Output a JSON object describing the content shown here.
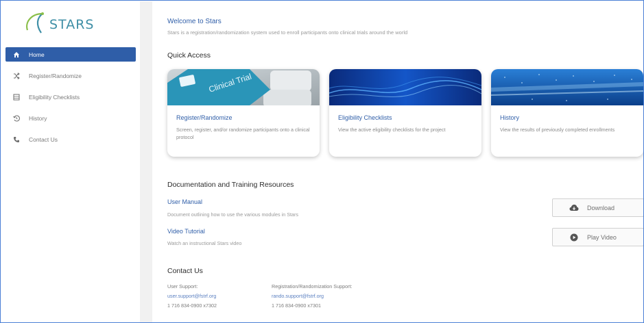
{
  "app": {
    "logo_text": "STARS"
  },
  "sidebar": {
    "items": [
      {
        "label": "Home",
        "icon": "home-icon",
        "active": true
      },
      {
        "label": "Register/Randomize",
        "icon": "shuffle-icon",
        "active": false
      },
      {
        "label": "Eligibility Checklists",
        "icon": "list-icon",
        "active": false
      },
      {
        "label": "History",
        "icon": "history-icon",
        "active": false
      },
      {
        "label": "Contact Us",
        "icon": "phone-icon",
        "active": false
      }
    ]
  },
  "welcome": {
    "title": "Welcome to Stars",
    "subtitle": "Stars is a registration/randomization system used to enroll participants onto clinical trials around the world"
  },
  "quick_access": {
    "title": "Quick Access",
    "cards": [
      {
        "title": "Register/Randomize",
        "text": "Screen, register, and/or randomize participants onto a clinical protocol",
        "image_text": "Clinical Trial"
      },
      {
        "title": "Eligibility Checklists",
        "text": "View the active eligibility checklists for the project"
      },
      {
        "title": "History",
        "text": "View the results of previously completed enrollments"
      }
    ]
  },
  "documentation": {
    "title": "Documentation and Training Resources",
    "items": [
      {
        "title": "User Manual",
        "desc": "Document outlining how to use the various modules in Stars",
        "button": "Download",
        "icon": "cloud-download-icon"
      },
      {
        "title": "Video Tutorial",
        "desc": "Watch an instructional Stars video",
        "button": "Play Video",
        "icon": "play-circle-icon"
      }
    ]
  },
  "contact": {
    "title": "Contact Us",
    "user_support": {
      "label": "User Support:",
      "email": "user.support@fstrf.org",
      "phone": "1 716 834-0900 x7302"
    },
    "reg_support": {
      "label": "Registration/Randomization Support:",
      "email": "rando.support@fstrf.org",
      "phone": "1 716 834-0900 x7301"
    }
  },
  "colors": {
    "accent": "#2f5ea8",
    "link": "#2f5ea8",
    "frame": "#4a7fd6"
  }
}
